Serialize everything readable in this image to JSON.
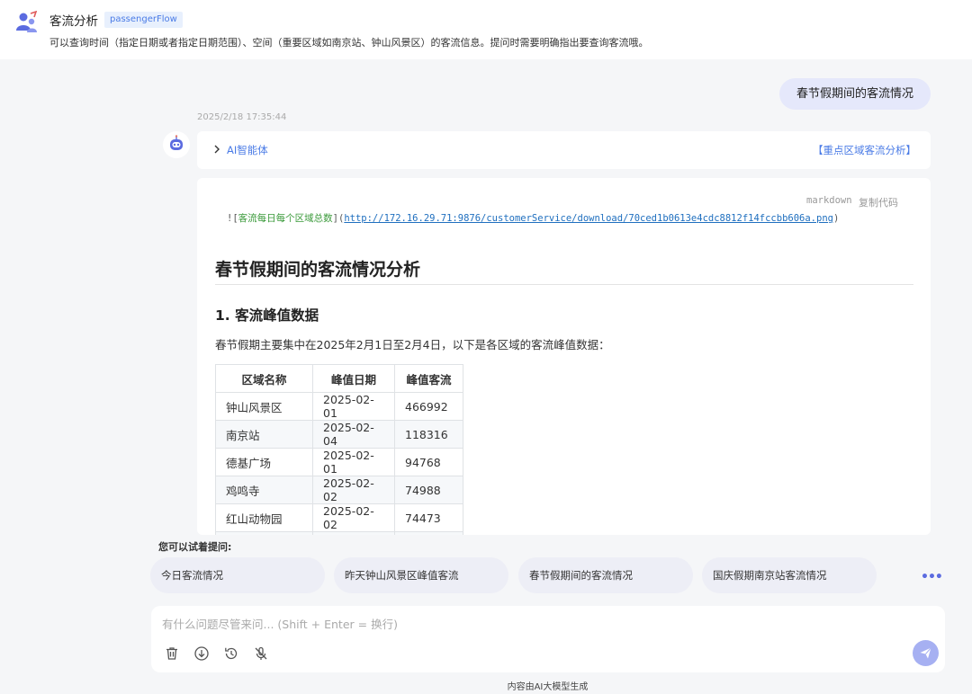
{
  "header": {
    "title": "客流分析",
    "tag": "passengerFlow",
    "description": "可以查询时间（指定日期或者指定日期范围）、空间（重要区域如南京站、钟山风景区）的客流信息。提问时需要明确指出要查询客流哦。"
  },
  "chat": {
    "user_message": "春节假期间的客流情况",
    "timestamp": "2025/2/18 17:35:44",
    "agent_label": "AI智能体",
    "tool_label": "【重点区域客流分析】"
  },
  "content": {
    "code_lang": "markdown",
    "code_copy": "复制代码",
    "code_prefix": "![",
    "code_alt": "客流每日每个区域总数",
    "code_mid": "](",
    "code_url": "http://172.16.29.71:9876/customerService/download/70ced1b0613e4cdc8812f14fccbb606a.png",
    "code_suffix": ")",
    "h1": "春节假期间的客流情况分析",
    "h2": "1. 客流峰值数据",
    "paragraph": "春节假期主要集中在2025年2月1日至2月4日，以下是各区域的客流峰值数据：",
    "table": {
      "headers": [
        "区域名称",
        "峰值日期",
        "峰值客流"
      ],
      "rows": [
        [
          "钟山风景区",
          "2025-02-01",
          "466992"
        ],
        [
          "南京站",
          "2025-02-04",
          "118316"
        ],
        [
          "德基广场",
          "2025-02-01",
          "94768"
        ],
        [
          "鸡鸣寺",
          "2025-02-02",
          "74988"
        ],
        [
          "红山动物园",
          "2025-02-02",
          "74473"
        ]
      ]
    }
  },
  "suggestions": {
    "title": "您可以试着提问:",
    "items": [
      "今日客流情况",
      "昨天钟山风景区峰值客流",
      "春节假期间的客流情况",
      "国庆假期南京站客流情况"
    ]
  },
  "input": {
    "placeholder": "有什么问题尽管来问... (Shift + Enter = 换行)"
  },
  "footer": {
    "note": "内容由AI大模型生成"
  },
  "colors": {
    "accent": "#4a7be6",
    "chip_bg": "#edeef6",
    "user_bubble": "#e5e8fb",
    "send_button": "#a6b0f2"
  }
}
